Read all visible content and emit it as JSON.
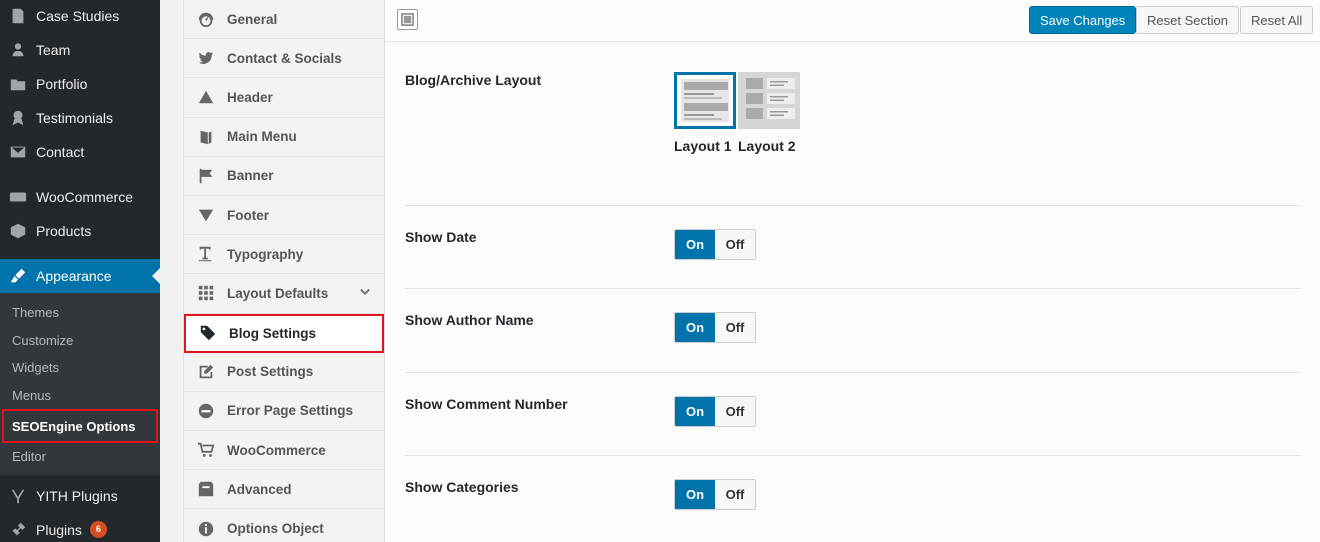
{
  "wp_menu": {
    "items": [
      {
        "label": "Case Studies",
        "icon": "document-icon"
      },
      {
        "label": "Team",
        "icon": "user-icon"
      },
      {
        "label": "Portfolio",
        "icon": "folder-icon"
      },
      {
        "label": "Testimonials",
        "icon": "award-icon"
      },
      {
        "label": "Contact",
        "icon": "envelope-icon"
      }
    ],
    "woo_items": [
      {
        "label": "WooCommerce",
        "icon": "woo-icon"
      },
      {
        "label": "Products",
        "icon": "box-icon"
      }
    ],
    "appearance": {
      "label": "Appearance",
      "icon": "paintbrush-icon"
    },
    "appearance_sub": [
      "Themes",
      "Customize",
      "Widgets",
      "Menus",
      "SEOEngine Options",
      "Editor"
    ],
    "bottom_items": [
      {
        "label": "YITH Plugins",
        "icon": "yith-icon"
      },
      {
        "label": "Plugins",
        "icon": "plug-icon",
        "badge": "6"
      }
    ]
  },
  "options_nav": {
    "items": [
      "General",
      "Contact & Socials",
      "Header",
      "Main Menu",
      "Banner",
      "Footer",
      "Typography",
      "Layout Defaults",
      "Blog Settings",
      "Post Settings",
      "Error Page Settings",
      "WooCommerce",
      "Advanced",
      "Options Object"
    ],
    "active": "Blog Settings"
  },
  "toolbar": {
    "save_label": "Save Changes",
    "reset_section_label": "Reset Section",
    "reset_all_label": "Reset All"
  },
  "settings": {
    "layout": {
      "label": "Blog/Archive Layout",
      "option1": "Layout 1",
      "option2": "Layout 2",
      "selected": "Layout 1"
    },
    "show_date": {
      "label": "Show Date",
      "on": "On",
      "off": "Off",
      "value": "On"
    },
    "show_author": {
      "label": "Show Author Name",
      "on": "On",
      "off": "Off",
      "value": "On"
    },
    "show_comments": {
      "label": "Show Comment Number",
      "on": "On",
      "off": "Off",
      "value": "On"
    },
    "show_categories": {
      "label": "Show Categories",
      "on": "On",
      "off": "Off",
      "value": "On"
    }
  },
  "colors": {
    "accent": "#0073aa",
    "sidebar_bg": "#23282d",
    "highlight_border": "#e0141e",
    "badge": "#d54e21"
  }
}
